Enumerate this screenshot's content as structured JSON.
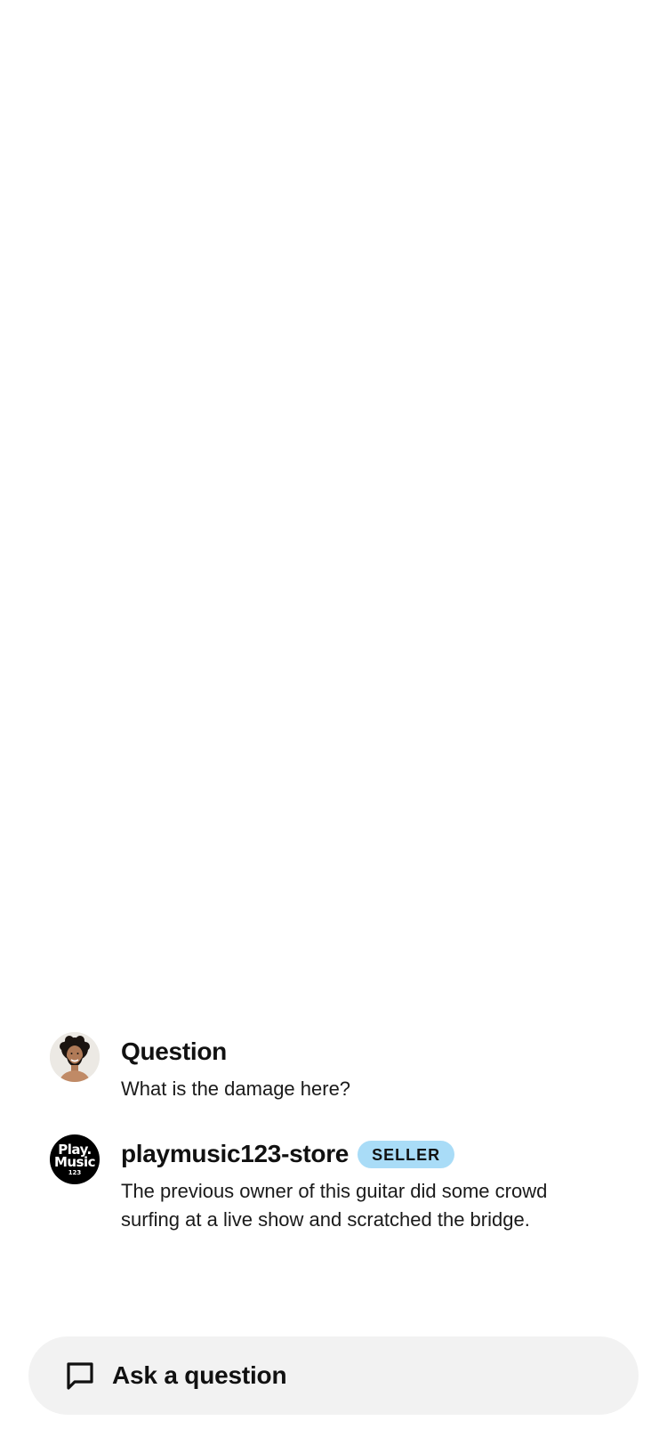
{
  "thread": {
    "question": {
      "avatar_icon": "person-avatar",
      "title": "Question",
      "text": "What is the damage here?"
    },
    "answer": {
      "avatar_icon": "store-logo-avatar",
      "logo_text": [
        "Play.",
        "Music",
        "123"
      ],
      "author": "playmusic123-store",
      "badge": "SELLER",
      "text": "The previous owner of this guitar did some crowd surfing at a live show and scratched the bridge."
    }
  },
  "ask_bar": {
    "icon": "chat-bubble-icon",
    "label": "Ask a question"
  },
  "colors": {
    "badge_bg": "#a9dcf7",
    "ask_bar_bg": "#f2f2f2",
    "text": "#111111"
  }
}
